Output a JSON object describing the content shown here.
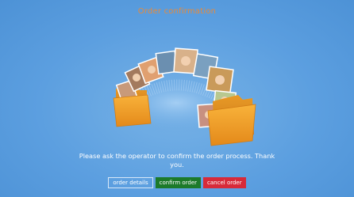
{
  "window": {
    "title": "Order confirmation"
  },
  "message": "Please ask the operator to confirm the order process. Thank you.",
  "buttons": {
    "details": "order details",
    "confirm": "confirm order",
    "cancel": "cancel order"
  },
  "colors": {
    "background": "#5c9fe0",
    "title": "#e88a3a",
    "folder": "#f4a12c",
    "confirm": "#1c7a2a",
    "cancel": "#d72a3a"
  },
  "illustration": {
    "icon": "photo-folders-icon"
  }
}
